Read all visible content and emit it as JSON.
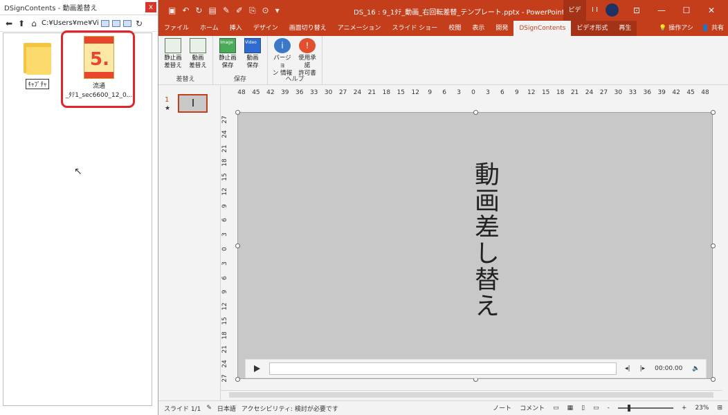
{
  "left_window": {
    "title": "DSignContents - 動画差替え",
    "close": "x",
    "path": "C:¥Users¥me¥Videc",
    "files": [
      {
        "label": "ｷｬﾌﾟﾁｬ"
      },
      {
        "label_line1": "流通",
        "label_line2": "_ﾀﾃ1_sec6600_12_0..."
      }
    ],
    "thumb_big": "5."
  },
  "ppt": {
    "doc_title": "DS_16 : 9_1ﾀﾃ_動画_右回転差替_テンプレート.pptx - PowerPoint",
    "context_tab": "ビデ",
    "user_initials": "I I",
    "tabs": [
      "ファイル",
      "ホーム",
      "挿入",
      "デザイン",
      "画面切り替え",
      "アニメーション",
      "スライド ショー",
      "校閲",
      "表示",
      "開発",
      "DSignContents",
      "ビデオ形式",
      "再生"
    ],
    "tell_me": "操作アシ",
    "share": "共有",
    "ribbon": {
      "groups": [
        {
          "name": "差替え",
          "buttons": [
            {
              "l1": "静止画",
              "l2": "差替え"
            },
            {
              "l1": "動画",
              "l2": "差替え"
            }
          ]
        },
        {
          "name": "保存",
          "buttons": [
            {
              "l1": "静止画",
              "l2": "保存"
            },
            {
              "l1": "動画",
              "l2": "保存"
            }
          ]
        },
        {
          "name": "ヘルプ",
          "buttons": [
            {
              "l1": "バージョ",
              "l2": "ン 情報"
            },
            {
              "l1": "使用承諾",
              "l2": "許可書"
            }
          ]
        }
      ],
      "icon_labels": [
        "Image",
        "Video"
      ]
    },
    "slide_number": "1",
    "slide_star": "★",
    "ruler_h": [
      "48",
      "45",
      "42",
      "39",
      "36",
      "33",
      "30",
      "27",
      "24",
      "21",
      "18",
      "15",
      "12",
      "9",
      "6",
      "3",
      "0",
      "3",
      "6",
      "9",
      "12",
      "15",
      "18",
      "21",
      "24",
      "27",
      "30",
      "33",
      "36",
      "39",
      "42",
      "45",
      "48"
    ],
    "ruler_v": [
      "27",
      "24",
      "21",
      "18",
      "15",
      "12",
      "9",
      "6",
      "3",
      "0",
      "3",
      "6",
      "9",
      "12",
      "15",
      "18",
      "21",
      "24",
      "27"
    ],
    "slide_text": "動画差し替え",
    "player_time": "00:00.00",
    "status": {
      "slide": "スライド 1/1",
      "lang": "日本語",
      "accessibility": "アクセシビリティ: 検討が必要です",
      "notes": "ノート",
      "comments": "コメント",
      "zoom_minus": "-",
      "zoom_plus": "+",
      "zoom": "23%"
    },
    "window_controls": [
      "—",
      "☐",
      "✕"
    ]
  }
}
